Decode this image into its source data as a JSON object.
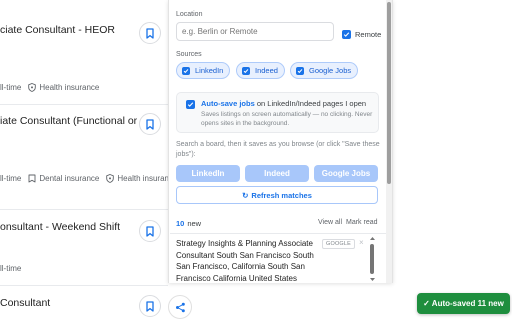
{
  "jobs": [
    {
      "title": "ciate Consultant - HEOR",
      "meta": [
        {
          "icon": "clock-icon",
          "text": "ll-time"
        },
        {
          "icon": "shield-icon",
          "text": "Health insurance"
        }
      ]
    },
    {
      "title_line1": "iate Consultant (Functional or",
      "title_line2": "",
      "meta": [
        {
          "icon": "clock-icon",
          "text": "ll-time"
        },
        {
          "icon": "tooth-icon",
          "text": "Dental insurance"
        },
        {
          "icon": "shield-icon",
          "text": "Health insurance"
        }
      ]
    },
    {
      "title": "onsultant - Weekend Shift",
      "meta": [
        {
          "icon": "clock-icon",
          "text": "ll-time"
        }
      ]
    },
    {
      "title": "Consultant"
    }
  ],
  "panel": {
    "location": {
      "label": "Location",
      "placeholder": "e.g. Berlin or Remote",
      "value": ""
    },
    "remote": {
      "label": "Remote",
      "checked": true
    },
    "sources": {
      "label": "Sources",
      "chips": [
        {
          "label": "LinkedIn",
          "checked": true
        },
        {
          "label": "Indeed",
          "checked": true
        },
        {
          "label": "Google Jobs",
          "checked": true
        }
      ]
    },
    "autosave": {
      "bold": "Auto-save jobs",
      "rest": " on LinkedIn/Indeed pages I open",
      "description": "Saves listings on screen automatically — no clicking. Never opens sites in the background.",
      "checked": true
    },
    "hint": "Search a board, then it saves as you browse (or click \"Save these jobs\"):",
    "source_buttons": [
      "LinkedIn",
      "Indeed",
      "Google Jobs"
    ],
    "refresh": {
      "icon": "↻",
      "label": "Refresh matches"
    },
    "results": {
      "count": "10",
      "count_suffix": "new",
      "view_all": "View all",
      "mark_read": "Mark read",
      "items": [
        {
          "title": "Strategy Insights & Planning Associate Consultant South San Francisco South San Francisco, California South San Francisco California United States",
          "tag": "GOOGLE",
          "close": "×"
        }
      ]
    }
  },
  "toast": {
    "text": "✓ Auto-saved 11 new"
  },
  "colors": {
    "accent": "#1a73e8",
    "toast": "#1e8e3e",
    "chip_bg": "#e8f0fe",
    "source_button": "#a8c7fa"
  }
}
